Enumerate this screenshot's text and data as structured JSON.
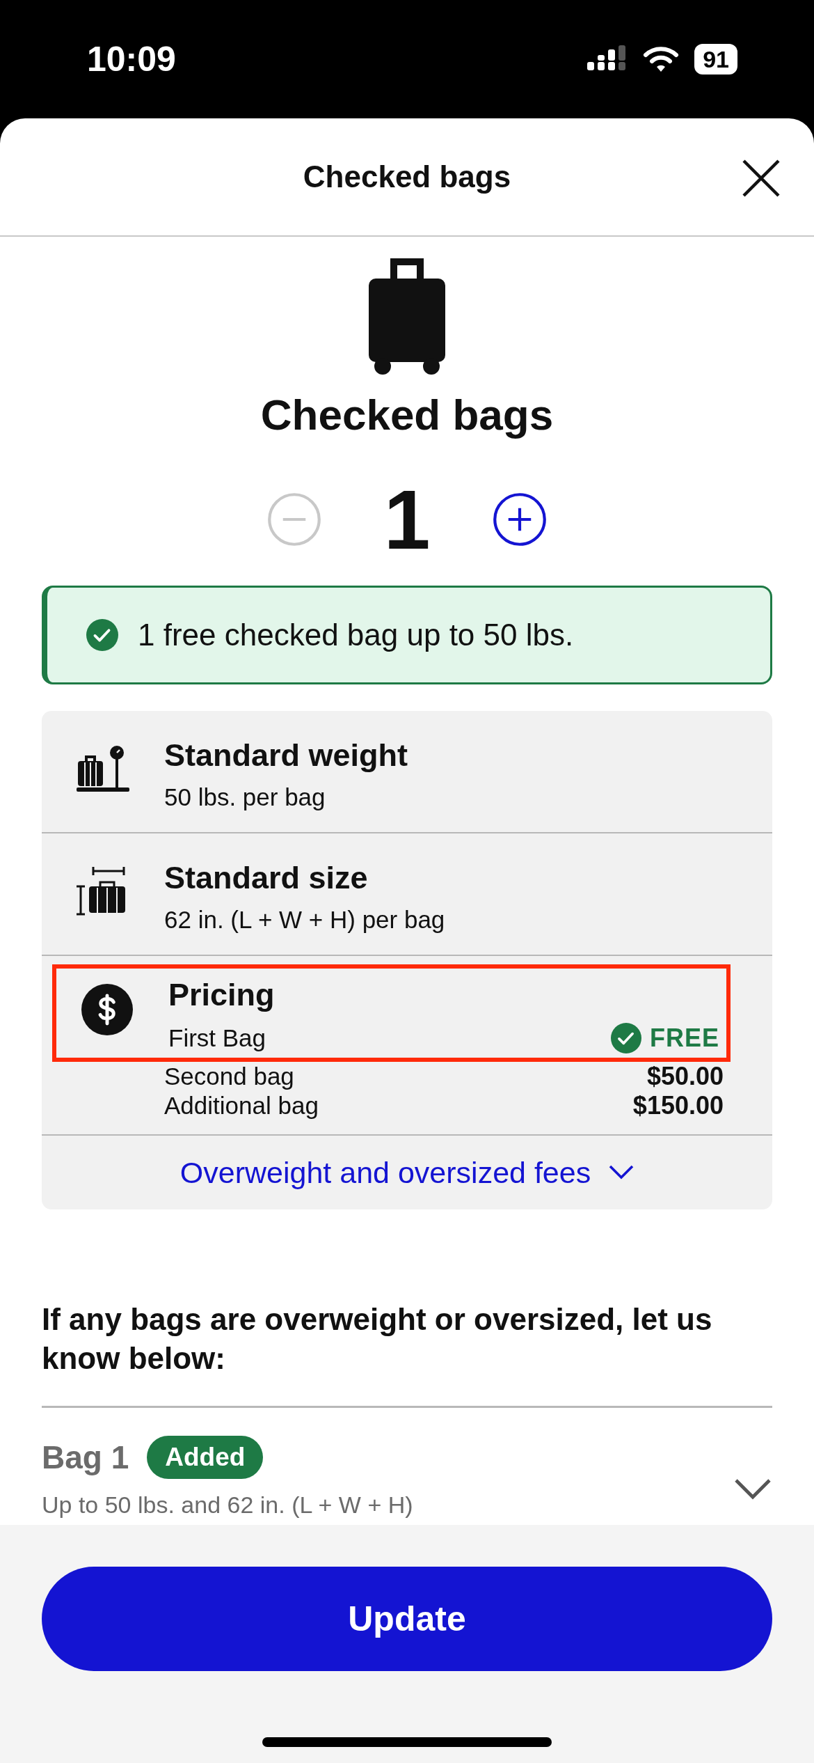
{
  "status_bar": {
    "time": "10:09",
    "battery": "91"
  },
  "header": {
    "title": "Checked bags"
  },
  "hero": {
    "title": "Checked bags"
  },
  "stepper": {
    "count": "1",
    "minus_disabled": true,
    "plus_disabled": false
  },
  "banner": {
    "text": "1 free checked bag up to 50 lbs."
  },
  "info_items": [
    {
      "kind": "weight",
      "title": "Standard weight",
      "subtitle": "50 lbs. per bag"
    },
    {
      "kind": "size",
      "title": "Standard size",
      "subtitle": "62 in. (L + W + H) per bag"
    },
    {
      "kind": "pricing",
      "title": "Pricing",
      "highlighted": true,
      "prices": [
        {
          "label": "First Bag",
          "value": "FREE",
          "free": true
        },
        {
          "label": "Second bag",
          "value": "$50.00",
          "free": false
        },
        {
          "label": "Additional bag",
          "value": "$150.00",
          "free": false
        }
      ]
    }
  ],
  "fees_link": {
    "label": "Overweight and oversized fees",
    "expanded": false
  },
  "question": "If any bags are overweight or oversized, let us know below:",
  "bags": [
    {
      "label": "Bag 1",
      "badge": "Added",
      "detail": "Up to 50 lbs. and 62 in. (L + W + H)",
      "expanded": false
    }
  ],
  "update_button": "Update"
}
